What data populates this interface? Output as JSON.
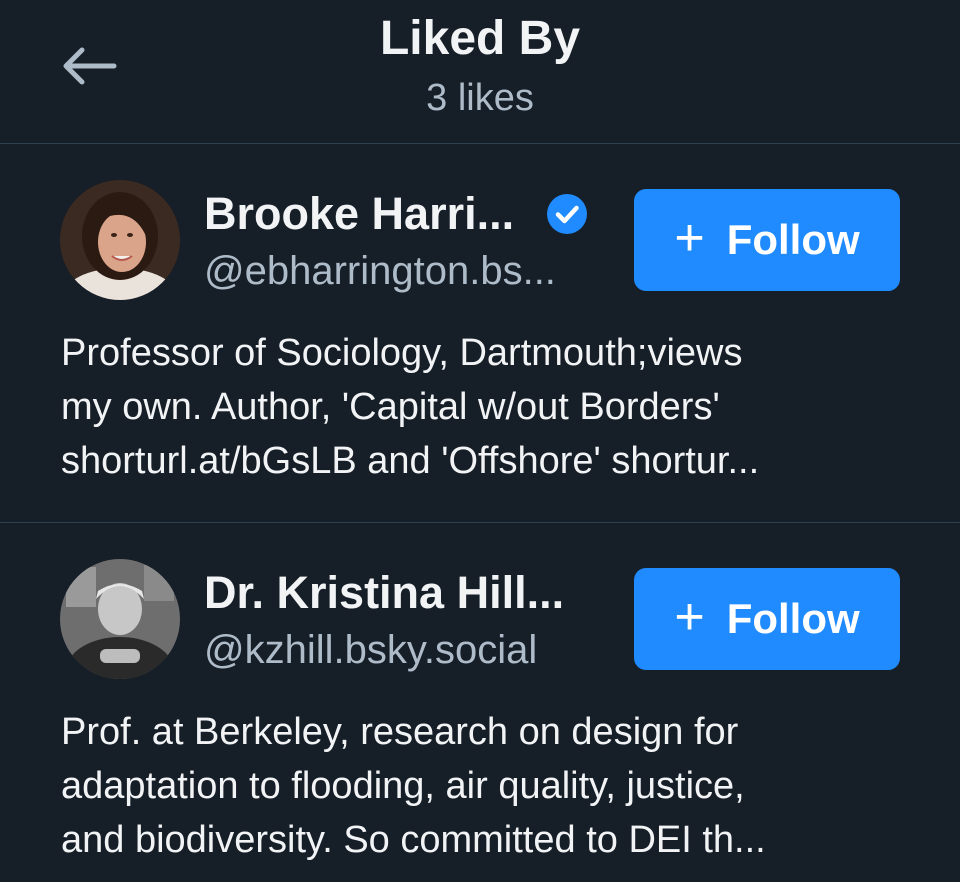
{
  "header": {
    "title": "Liked By",
    "subtitle": "3 likes",
    "back_icon": "arrow-left-icon"
  },
  "colors": {
    "background": "#161e27",
    "divider": "#2e4052",
    "text_primary": "#f1f3f5",
    "text_secondary": "#aebbc9",
    "accent": "#208bfe"
  },
  "users": [
    {
      "display_name": "Brooke Harri...",
      "handle": "@ebharrington.bs...",
      "verified": true,
      "verified_icon": "verified-check-icon",
      "follow_plus": "+",
      "follow_label": "Follow",
      "bio_lines": [
        "Professor of Sociology, Dartmouth;views",
        "my own. Author, 'Capital w/out Borders'",
        "shorturl.at/bGsLB and 'Offshore' shortur..."
      ]
    },
    {
      "display_name": "Dr. Kristina Hill...",
      "handle": "@kzhill.bsky.social",
      "verified": false,
      "follow_plus": "+",
      "follow_label": "Follow",
      "bio_lines": [
        "Prof. at Berkeley, research on design for",
        "adaptation to flooding, air quality, justice,",
        "and biodiversity. So committed to DEI th..."
      ]
    }
  ]
}
